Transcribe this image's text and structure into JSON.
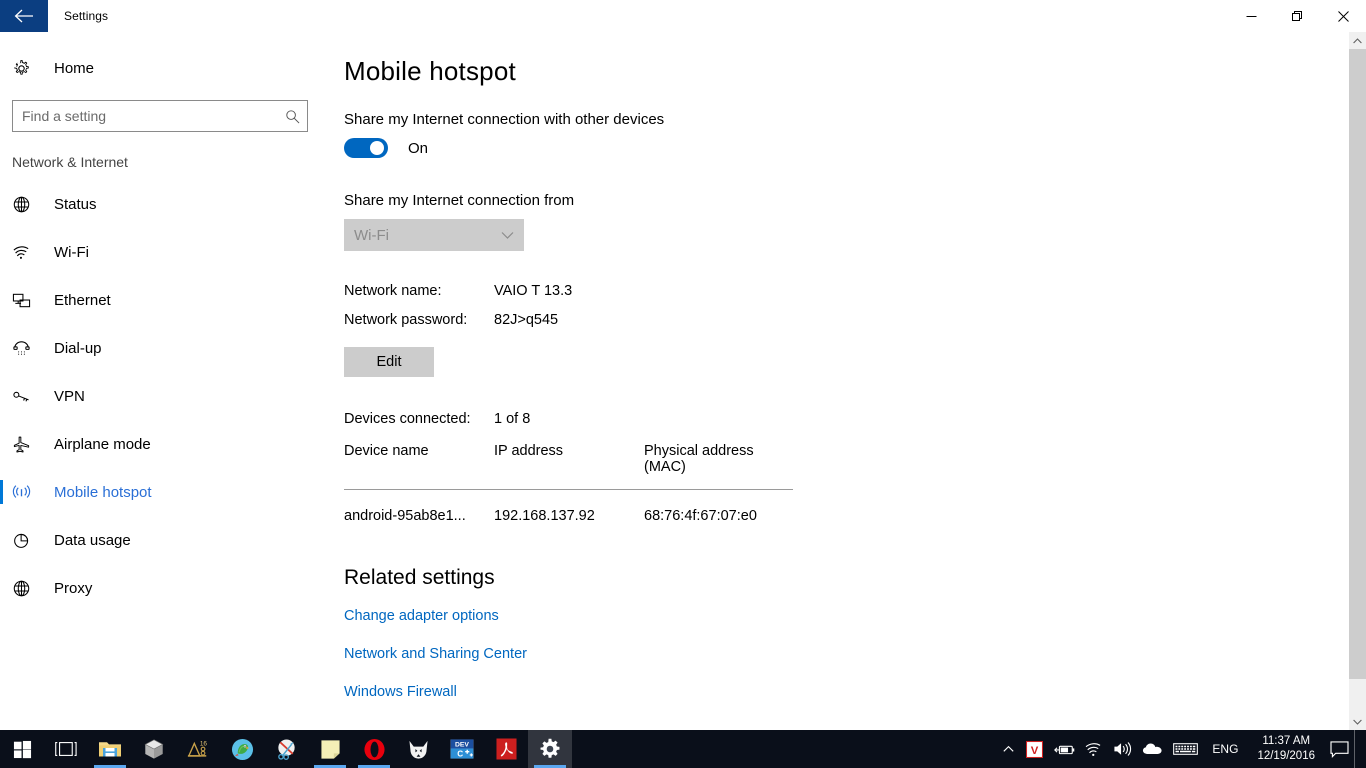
{
  "titlebar": {
    "app_title": "Settings",
    "back_icon": "back-arrow-icon",
    "minimize_label": "—",
    "restore_label": "restore-icon",
    "close_label": "✕",
    "accent_color": "#0b3e81"
  },
  "sidebar": {
    "home_label": "Home",
    "home_icon": "gear-icon",
    "search": {
      "placeholder": "Find a setting",
      "value": "",
      "icon": "search-icon"
    },
    "group_header": "Network & Internet",
    "selected": "Mobile hotspot",
    "accent_color": "#0078d7",
    "selected_text_color": "#2a6fd6",
    "items": [
      {
        "label": "Status",
        "icon": "globe-icon"
      },
      {
        "label": "Wi-Fi",
        "icon": "wifi-icon"
      },
      {
        "label": "Ethernet",
        "icon": "ethernet-icon"
      },
      {
        "label": "Dial-up",
        "icon": "dialup-phone-icon"
      },
      {
        "label": "VPN",
        "icon": "vpn-key-icon"
      },
      {
        "label": "Airplane mode",
        "icon": "airplane-icon"
      },
      {
        "label": "Mobile hotspot",
        "icon": "broadcast-icon"
      },
      {
        "label": "Data usage",
        "icon": "pie-chart-icon"
      },
      {
        "label": "Proxy",
        "icon": "globe-icon"
      }
    ]
  },
  "main": {
    "page_title": "Mobile hotspot",
    "share_label": "Share my Internet connection with other devices",
    "toggle": {
      "state_label": "On",
      "on": true,
      "color": "#0067c0"
    },
    "share_from_label": "Share my Internet connection from",
    "share_from_dropdown": {
      "value": "Wi-Fi",
      "disabled": true,
      "chevron_icon": "chevron-down-icon"
    },
    "network_name_key": "Network name:",
    "network_name_value": "VAIO T 13.3",
    "network_password_key": "Network password:",
    "network_password_value": "82J>q545",
    "edit_button": "Edit",
    "devices_connected_key": "Devices connected:",
    "devices_connected_value": "1 of 8",
    "table": {
      "columns": [
        "Device name",
        "IP address",
        "Physical address (MAC)"
      ],
      "rows": [
        {
          "device_name": "android-95ab8e1...",
          "ip_address": "192.168.137.92",
          "mac_address": "68:76:4f:67:07:e0"
        }
      ]
    },
    "related_title": "Related settings",
    "related_links": [
      "Change adapter options",
      "Network and Sharing Center",
      "Windows Firewall"
    ],
    "link_color": "#0067c0"
  },
  "scrollbar": {
    "up_arrow": "chevron-up-icon",
    "down_arrow": "chevron-down-icon"
  },
  "taskbar": {
    "background": "#0a0f1a",
    "indicator_color": "#5ba7f0",
    "apps": [
      {
        "name": "start-button",
        "icon": "windows-logo-icon",
        "running": false
      },
      {
        "name": "task-view-button",
        "icon": "task-view-icon",
        "running": false
      },
      {
        "name": "file-explorer",
        "icon": "folder-icon",
        "running": true
      },
      {
        "name": "virtualbox",
        "icon": "cube-icon",
        "running": false
      },
      {
        "name": "autocad",
        "icon": "cad-ruler-icon",
        "running": false
      },
      {
        "name": "parrot-app",
        "icon": "parrot-icon",
        "running": false
      },
      {
        "name": "snipping-tool",
        "icon": "scissors-icon",
        "running": false
      },
      {
        "name": "sticky-notes",
        "icon": "note-icon",
        "running": true
      },
      {
        "name": "opera-browser",
        "icon": "opera-o-icon",
        "running": true
      },
      {
        "name": "foobar2000",
        "icon": "fox-head-icon",
        "running": false
      },
      {
        "name": "dev-cpp",
        "icon": "dev-cpp-icon",
        "running": false
      },
      {
        "name": "adobe-reader",
        "icon": "adobe-pdf-icon",
        "running": false
      },
      {
        "name": "settings-app",
        "icon": "gear-icon",
        "running": true,
        "active": true
      }
    ],
    "tray": {
      "overflow_icon": "chevron-up-icon",
      "items": [
        {
          "name": "vuze-tray-icon",
          "icon": "red-v-icon"
        },
        {
          "name": "battery-tray-icon",
          "icon": "battery-icon"
        },
        {
          "name": "network-tray-icon",
          "icon": "wifi-icon"
        },
        {
          "name": "volume-tray-icon",
          "icon": "speaker-icon"
        },
        {
          "name": "onedrive-tray-icon",
          "icon": "cloud-icon"
        },
        {
          "name": "touch-keyboard-icon",
          "icon": "keyboard-icon"
        }
      ],
      "language": "ENG",
      "clock_time": "11:37 AM",
      "clock_date": "12/19/2016",
      "action_center_icon": "speech-bubble-icon"
    }
  }
}
